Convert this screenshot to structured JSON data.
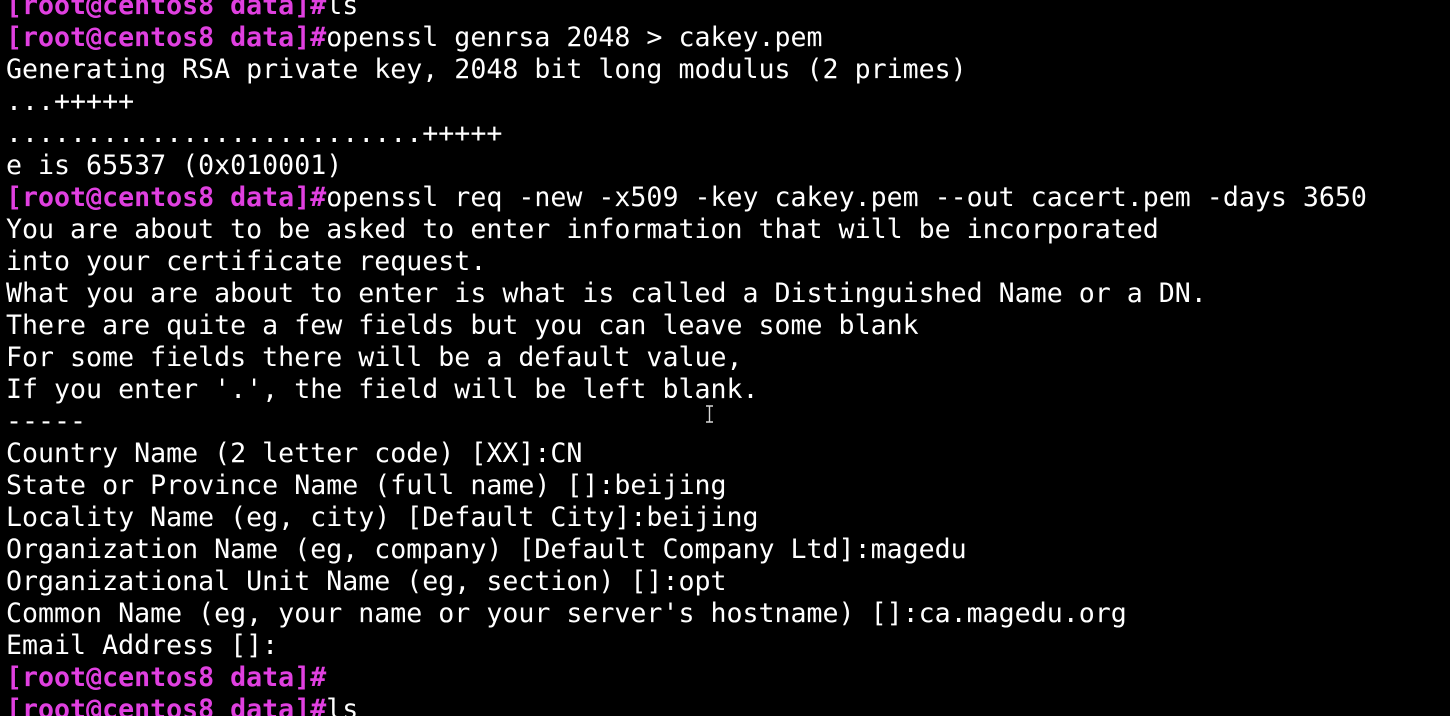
{
  "terminal": {
    "prompt": "[root@centos8 data]#",
    "prompt_color": "#e040e0",
    "text_color": "#ffffff",
    "background": "#000000",
    "lines": [
      {
        "prompt": true,
        "text": "ls"
      },
      {
        "prompt": true,
        "text": "openssl genrsa 2048 > cakey.pem"
      },
      {
        "prompt": false,
        "text": "Generating RSA private key, 2048 bit long modulus (2 primes)"
      },
      {
        "prompt": false,
        "text": "...+++++"
      },
      {
        "prompt": false,
        "text": "..........................+++++"
      },
      {
        "prompt": false,
        "text": "e is 65537 (0x010001)"
      },
      {
        "prompt": true,
        "text": "openssl req -new -x509 -key cakey.pem --out cacert.pem -days 3650"
      },
      {
        "prompt": false,
        "text": "You are about to be asked to enter information that will be incorporated"
      },
      {
        "prompt": false,
        "text": "into your certificate request."
      },
      {
        "prompt": false,
        "text": "What you are about to enter is what is called a Distinguished Name or a DN."
      },
      {
        "prompt": false,
        "text": "There are quite a few fields but you can leave some blank"
      },
      {
        "prompt": false,
        "text": "For some fields there will be a default value,"
      },
      {
        "prompt": false,
        "text": "If you enter '.', the field will be left blank."
      },
      {
        "prompt": false,
        "text": "-----"
      },
      {
        "prompt": false,
        "text": "Country Name (2 letter code) [XX]:CN"
      },
      {
        "prompt": false,
        "text": "State or Province Name (full name) []:beijing"
      },
      {
        "prompt": false,
        "text": "Locality Name (eg, city) [Default City]:beijing"
      },
      {
        "prompt": false,
        "text": "Organization Name (eg, company) [Default Company Ltd]:magedu"
      },
      {
        "prompt": false,
        "text": "Organizational Unit Name (eg, section) []:opt"
      },
      {
        "prompt": false,
        "text": "Common Name (eg, your name or your server's hostname) []:ca.magedu.org"
      },
      {
        "prompt": false,
        "text": "Email Address []:"
      },
      {
        "prompt": true,
        "text": ""
      },
      {
        "prompt": true,
        "text": "ls"
      }
    ]
  },
  "cursor": {
    "icon": "text-ibeam-cursor-icon"
  }
}
